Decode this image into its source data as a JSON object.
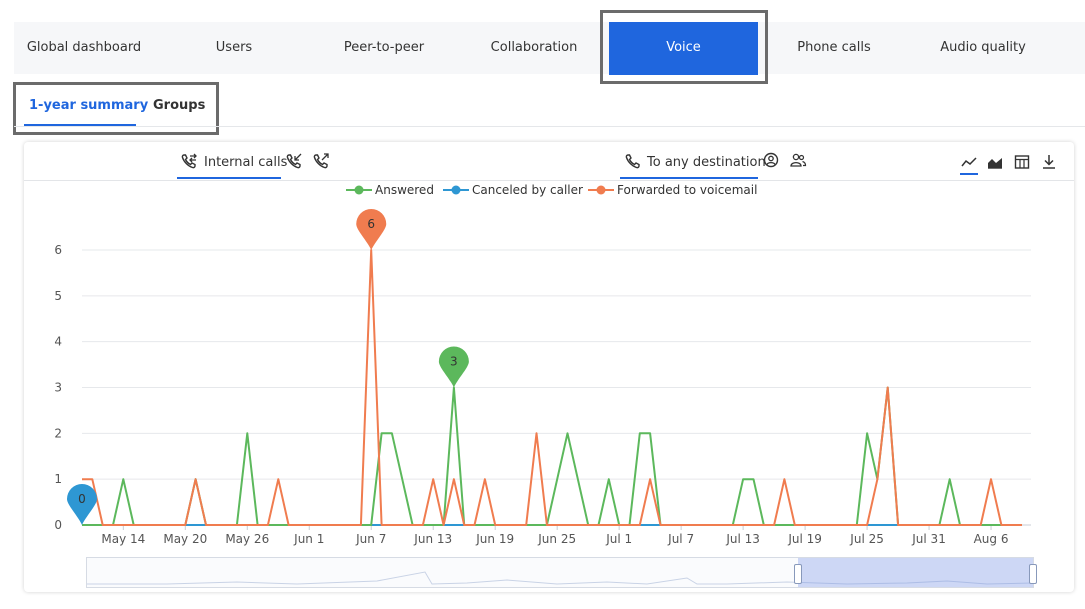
{
  "nav": {
    "tabs": [
      {
        "label": "Global dashboard",
        "active": false
      },
      {
        "label": "Users",
        "active": false
      },
      {
        "label": "Peer-to-peer",
        "active": false
      },
      {
        "label": "Collaboration",
        "active": false
      },
      {
        "label": "Voice",
        "active": true
      },
      {
        "label": "Phone calls",
        "active": false
      },
      {
        "label": "Audio quality",
        "active": false
      }
    ]
  },
  "subtabs": [
    {
      "label": "1-year summary",
      "selected": true
    },
    {
      "label": "Groups",
      "selected": false
    }
  ],
  "toolbar": {
    "internal_calls_label": "Internal calls",
    "destination_label": "To any destination",
    "icons": [
      "call-transfer-icon",
      "call-incoming-icon",
      "call-outgoing-icon",
      "phone-icon",
      "person-circle-icon",
      "people-icon",
      "line-chart-icon",
      "area-chart-icon",
      "table-icon",
      "download-icon"
    ]
  },
  "colors": {
    "accent": "#1f66de",
    "answered": "#5cb85c",
    "canceled": "#2e97d3",
    "forwarded": "#f07c4f"
  },
  "chart_data": {
    "type": "line",
    "x_ticks": [
      "May 14",
      "May 20",
      "May 26",
      "Jun 1",
      "Jun 7",
      "Jun 13",
      "Jun 19",
      "Jun 25",
      "Jul 1",
      "Jul 7",
      "Jul 13",
      "Jul 19",
      "Jul 25",
      "Jul 31",
      "Aug 6"
    ],
    "x_start": "May 10",
    "x_end": "Aug 9",
    "y_ticks": [
      "0",
      "1",
      "2",
      "3",
      "4",
      "5",
      "6"
    ],
    "ylim": [
      0,
      6.5
    ],
    "legend_position": "top",
    "series": [
      {
        "name": "Answered",
        "color": "#5cb85c",
        "points": [
          [
            "May 10",
            0
          ],
          [
            "May 13",
            0
          ],
          [
            "May 14",
            1
          ],
          [
            "May 15",
            0
          ],
          [
            "May 20",
            0
          ],
          [
            "May 21",
            1
          ],
          [
            "May 22",
            0
          ],
          [
            "May 25",
            0
          ],
          [
            "May 26",
            2
          ],
          [
            "May 27",
            0
          ],
          [
            "Jun 7",
            0
          ],
          [
            "Jun 8",
            2
          ],
          [
            "Jun 9",
            2
          ],
          [
            "Jun 11",
            0
          ],
          [
            "Jun 14",
            0
          ],
          [
            "Jun 15",
            3
          ],
          [
            "Jun 16",
            0
          ],
          [
            "Jun 24",
            0
          ],
          [
            "Jun 26",
            2
          ],
          [
            "Jun 28",
            0
          ],
          [
            "Jun 29",
            0
          ],
          [
            "Jun 30",
            1
          ],
          [
            "Jul 1",
            0
          ],
          [
            "Jul 2",
            0
          ],
          [
            "Jul 3",
            2
          ],
          [
            "Jul 4",
            2
          ],
          [
            "Jul 5",
            0
          ],
          [
            "Jul 12",
            0
          ],
          [
            "Jul 13",
            1
          ],
          [
            "Jul 14",
            1
          ],
          [
            "Jul 15",
            0
          ],
          [
            "Jul 24",
            0
          ],
          [
            "Jul 25",
            2
          ],
          [
            "Jul 26",
            1
          ],
          [
            "Jul 27",
            3
          ],
          [
            "Jul 28",
            0
          ],
          [
            "Aug 1",
            0
          ],
          [
            "Aug 2",
            1
          ],
          [
            "Aug 3",
            0
          ],
          [
            "Aug 9",
            0
          ]
        ]
      },
      {
        "name": "Canceled by caller",
        "color": "#2e97d3",
        "points": [
          [
            "May 10",
            0
          ],
          [
            "Aug 9",
            0
          ]
        ]
      },
      {
        "name": "Forwarded to voicemail",
        "color": "#f07c4f",
        "points": [
          [
            "May 10",
            1
          ],
          [
            "May 11",
            1
          ],
          [
            "May 12",
            0
          ],
          [
            "May 20",
            0
          ],
          [
            "May 21",
            1
          ],
          [
            "May 22",
            0
          ],
          [
            "May 28",
            0
          ],
          [
            "May 29",
            1
          ],
          [
            "May 30",
            0
          ],
          [
            "Jun 6",
            0
          ],
          [
            "Jun 7",
            6
          ],
          [
            "Jun 8",
            0
          ],
          [
            "Jun 12",
            0
          ],
          [
            "Jun 13",
            1
          ],
          [
            "Jun 14",
            0
          ],
          [
            "Jun 15",
            1
          ],
          [
            "Jun 16",
            0
          ],
          [
            "Jun 17",
            0
          ],
          [
            "Jun 18",
            1
          ],
          [
            "Jun 19",
            0
          ],
          [
            "Jun 22",
            0
          ],
          [
            "Jun 23",
            2
          ],
          [
            "Jun 24",
            0
          ],
          [
            "Jul 3",
            0
          ],
          [
            "Jul 4",
            1
          ],
          [
            "Jul 5",
            0
          ],
          [
            "Jul 16",
            0
          ],
          [
            "Jul 17",
            1
          ],
          [
            "Jul 18",
            0
          ],
          [
            "Jul 25",
            0
          ],
          [
            "Jul 26",
            1
          ],
          [
            "Jul 27",
            3
          ],
          [
            "Jul 28",
            0
          ],
          [
            "Aug 5",
            0
          ],
          [
            "Aug 6",
            1
          ],
          [
            "Aug 7",
            0
          ],
          [
            "Aug 9",
            0
          ]
        ]
      }
    ],
    "markers": [
      {
        "series": "Canceled by caller",
        "x": "May 10",
        "y": 0,
        "label": "0",
        "color": "#2e97d3"
      },
      {
        "series": "Forwarded to voicemail",
        "x": "Jun 7",
        "y": 6,
        "label": "6",
        "color": "#f07c4f"
      },
      {
        "series": "Answered",
        "x": "Jun 15",
        "y": 3,
        "label": "3",
        "color": "#5cb85c"
      }
    ]
  }
}
